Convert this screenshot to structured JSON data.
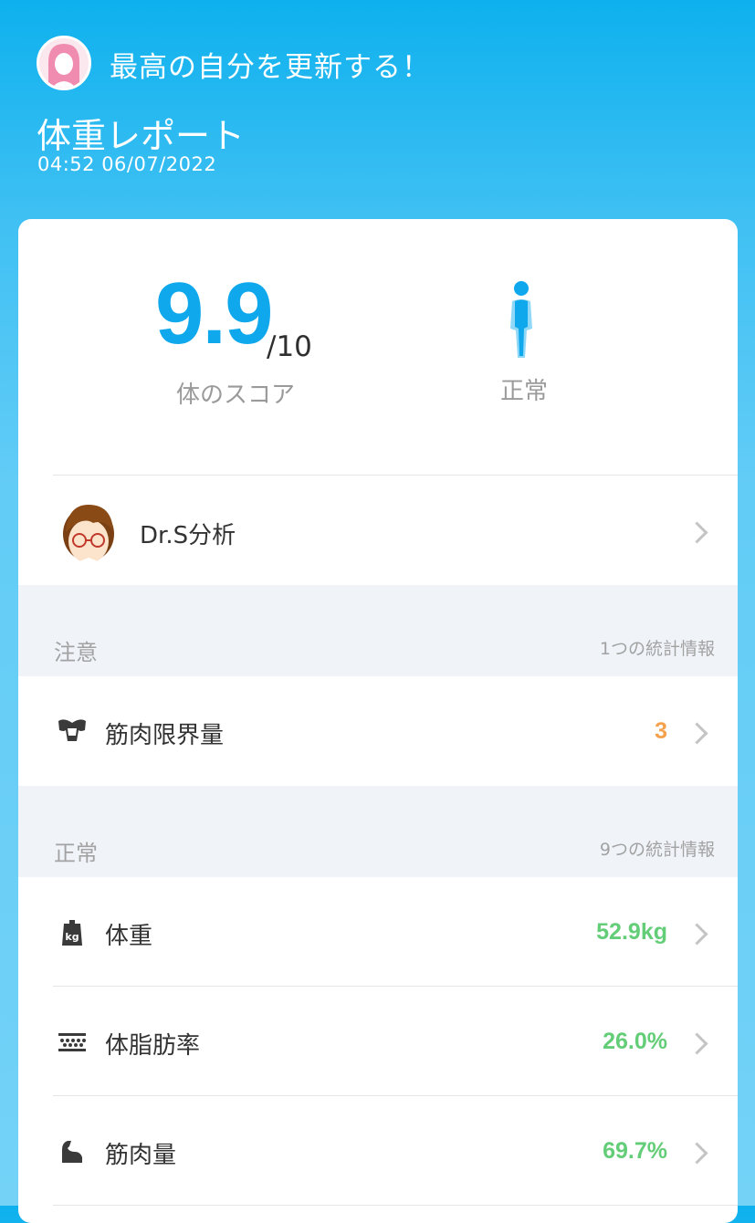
{
  "header": {
    "slogan": "最高の自分を更新する！",
    "title": "体重レポート",
    "timestamp": "04:52 06/07/2022"
  },
  "score": {
    "value": "9.9",
    "max": "/10",
    "label": "体のスコア",
    "body_type_label": "正常"
  },
  "doctor": {
    "label": "Dr.S分析"
  },
  "sections": [
    {
      "title": "注意",
      "count_text": "1つの統計情報",
      "items": [
        {
          "icon": "muscle-torso-icon",
          "label": "筋肉限界量",
          "value": "3",
          "color": "#f5a04a"
        }
      ]
    },
    {
      "title": "正常",
      "count_text": "9つの統計情報",
      "items": [
        {
          "icon": "kg-weight-icon",
          "label": "体重",
          "value": "52.9kg",
          "color": "#63cd78"
        },
        {
          "icon": "body-fat-icon",
          "label": "体脂肪率",
          "value": "26.0%",
          "color": "#63cd78"
        },
        {
          "icon": "arm-muscle-icon",
          "label": "筋肉量",
          "value": "69.7%",
          "color": "#63cd78"
        }
      ]
    }
  ],
  "colors": {
    "accent": "#0fa8ec",
    "warning": "#f5a04a",
    "normal": "#63cd78"
  }
}
